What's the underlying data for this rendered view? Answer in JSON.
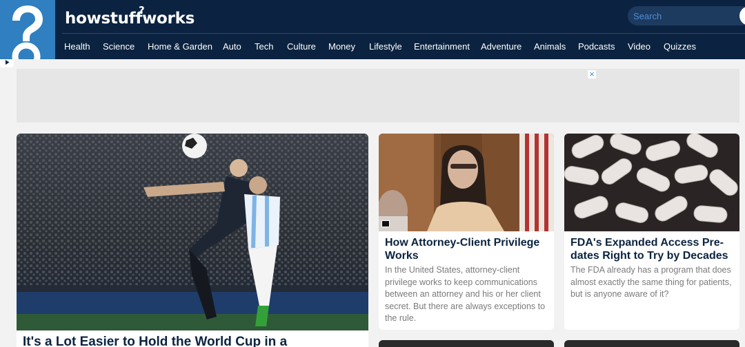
{
  "brand": {
    "name": "howstuffworks",
    "mark": "?"
  },
  "colors": {
    "header_bg": "#0b2340",
    "logo_bg": "#2f7fc1",
    "search_placeholder": "#4f8fd6",
    "ad_bg": "#e6e6e6"
  },
  "social": [
    {
      "icon": "shuffle-icon"
    },
    {
      "icon": "facebook-icon"
    },
    {
      "icon": "twitter-icon"
    },
    {
      "icon": "instagram-icon"
    },
    {
      "icon": "youtube-icon"
    }
  ],
  "search": {
    "placeholder": "Search"
  },
  "nav": [
    "Health",
    "Science",
    "Home & Garden",
    "Auto",
    "Tech",
    "Culture",
    "Money",
    "Lifestyle",
    "Entertainment",
    "Adventure",
    "Animals",
    "Podcasts",
    "Video",
    "Quizzes"
  ],
  "ad": {
    "close": "×"
  },
  "featured": {
    "title": "It's a Lot Easier to Hold the World Cup in a"
  },
  "articles": [
    {
      "title": "How Attorney-Client Privilege Works",
      "desc": "In the United States, attorney-client privilege works to keep communications between an attorney and his or her client secret. But there are always exceptions to the rule."
    },
    {
      "title": "FDA's Expanded Access Pre-dates Right to Try by Decades",
      "desc": "The FDA already has a program that does almost exactly the same thing for patients, but is anyone aware of it?"
    }
  ]
}
